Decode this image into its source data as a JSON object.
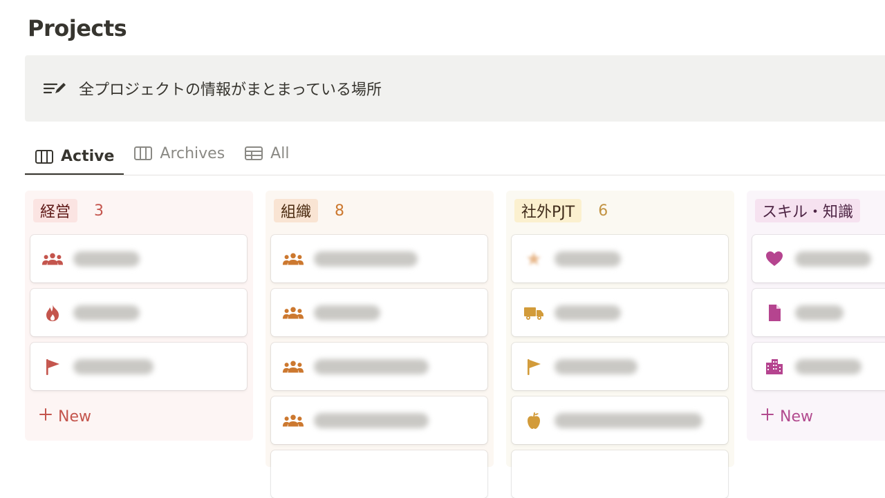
{
  "page": {
    "title": "Projects",
    "description": "全プロジェクトの情報がまとまっている場所"
  },
  "tabs": [
    {
      "label": "Active",
      "icon": "board-icon",
      "active": true
    },
    {
      "label": "Archives",
      "icon": "board-icon",
      "active": false
    },
    {
      "label": "All",
      "icon": "table-icon",
      "active": false
    }
  ],
  "new_label": "New",
  "columns": [
    {
      "label": "経営",
      "count": "3",
      "bg": "#fdf5f4",
      "chip_bg": "#fbe4e2",
      "chip_fg": "#5d1715",
      "count_fg": "#c4554d",
      "icon_color": "#c4554d",
      "cards": [
        {
          "icon": "team-icon"
        },
        {
          "icon": "fire-icon"
        },
        {
          "icon": "flag-icon"
        }
      ]
    },
    {
      "label": "組織",
      "count": "8",
      "bg": "#fcf7f2",
      "chip_bg": "#f9e4d3",
      "chip_fg": "#49290e",
      "count_fg": "#cc782f",
      "icon_color": "#cc782f",
      "cards": [
        {
          "icon": "team-icon"
        },
        {
          "icon": "team-icon"
        },
        {
          "icon": "team-icon"
        },
        {
          "icon": "team-icon"
        }
      ]
    },
    {
      "label": "社外PJT",
      "count": "6",
      "bg": "#fbf9f2",
      "chip_bg": "#fbf0cf",
      "chip_fg": "#402c1b",
      "count_fg": "#c29343",
      "icon_color": "#d29b3a",
      "cards": [
        {
          "icon": "star-icon"
        },
        {
          "icon": "truck-icon"
        },
        {
          "icon": "flag-icon"
        },
        {
          "icon": "apple-icon"
        }
      ]
    },
    {
      "label": "スキル・知識",
      "count": "",
      "bg": "#faf5fa",
      "chip_bg": "#f6e2f0",
      "chip_fg": "#4e2545",
      "count_fg": "#b24b8f",
      "icon_color": "#b5448f",
      "cards": [
        {
          "icon": "heart-icon"
        },
        {
          "icon": "document-icon"
        },
        {
          "icon": "building-icon"
        }
      ]
    }
  ]
}
